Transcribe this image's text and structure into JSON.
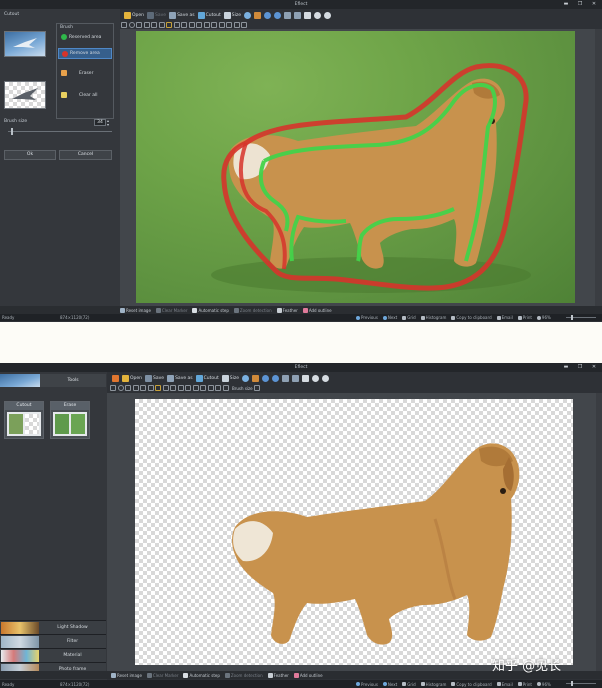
{
  "screen1": {
    "title": "Eflect",
    "left_title": "Cutout",
    "brush_title": "Brush",
    "brush_items": [
      {
        "label": "Reserved area",
        "color": "#2fb84a"
      },
      {
        "label": "Remove area",
        "color": "#d6342b"
      },
      {
        "label": "Eraser",
        "color": "#e8a14b"
      },
      {
        "label": "Clear all",
        "color": "#e9d060"
      }
    ],
    "brush_size_label": "Brush size",
    "brush_size_value": "34",
    "ok": "Ok",
    "cancel": "Cancel",
    "toolbar": {
      "open": "Open",
      "save": "Save",
      "save_as": "Save as",
      "cutout": "Cutout",
      "size": "Size"
    },
    "bottom": [
      "Reset image",
      "Clear Marker",
      "Automatic step",
      "Zoom detection",
      "Feather",
      "Add outline"
    ],
    "status": {
      "left": "Ready",
      "info": "874×1120(72)",
      "previous": "Previous",
      "next": "Next",
      "grid": "Grid",
      "histogram": "Histogram",
      "copy": "Copy to clipboard",
      "email": "Email",
      "print": "Print",
      "zoom": "96%"
    }
  },
  "screen2": {
    "title": "Eflect",
    "tools_label": "Tools",
    "tabs": [
      "Cutout",
      "Erase"
    ],
    "toolbar": {
      "open": "Open",
      "save": "Save",
      "save_as": "Save as",
      "cutout": "Cutout",
      "size": "Size"
    },
    "brush_size_label": "Brush size",
    "categories": [
      "Light Shadow",
      "Filter",
      "Material",
      "Photo frame"
    ],
    "bottom": [
      "Reset image",
      "Clear Marker",
      "Automatic step",
      "Zoom detection",
      "Feather",
      "Add outline"
    ],
    "status": {
      "left": "Ready",
      "info": "874×1120(72)",
      "previous": "Previous",
      "next": "Next",
      "grid": "Grid",
      "histogram": "Histogram",
      "copy": "Copy to clipboard",
      "email": "Email",
      "print": "Print",
      "zoom": "96%"
    }
  },
  "watermark": "知乎 @见长"
}
